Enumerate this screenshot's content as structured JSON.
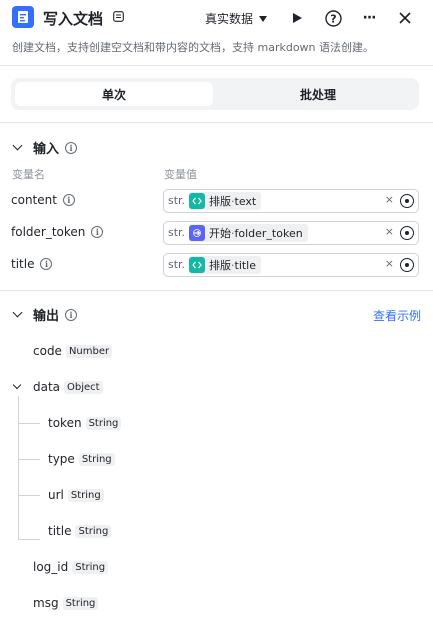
{
  "header": {
    "title": "写入文档",
    "data_mode": "真实数据",
    "description": "创建文档，支持创建空文档和带内容的文档，支持 markdown 语法创建。"
  },
  "tabs": [
    {
      "label": "单次",
      "active": true
    },
    {
      "label": "批处理",
      "active": false
    }
  ],
  "input": {
    "section_title": "输入",
    "col_name": "变量名",
    "col_value": "变量值",
    "params": [
      {
        "name": "content",
        "type": "str.",
        "source": "排版",
        "field": "text",
        "icon": "code-icon"
      },
      {
        "name": "folder_token",
        "type": "str.",
        "source": "开始",
        "field": "folder_token",
        "icon": "start-icon"
      },
      {
        "name": "title",
        "type": "str.",
        "source": "排版",
        "field": "title",
        "icon": "code-icon"
      }
    ]
  },
  "output": {
    "section_title": "输出",
    "example_link": "查看示例",
    "items": [
      {
        "name": "code",
        "type": "Number"
      },
      {
        "name": "data",
        "type": "Object",
        "children": [
          {
            "name": "token",
            "type": "String"
          },
          {
            "name": "type",
            "type": "String"
          },
          {
            "name": "url",
            "type": "String"
          },
          {
            "name": "title",
            "type": "String"
          }
        ]
      },
      {
        "name": "log_id",
        "type": "String"
      },
      {
        "name": "msg",
        "type": "String"
      }
    ]
  },
  "ui": {
    "separator": " · ",
    "clear_glyph": "×",
    "info_glyph": "i",
    "play_glyph": "▶",
    "help_glyph": "?",
    "more_glyph": "···",
    "close_glyph": "✕"
  },
  "colors": {
    "accent": "#3370ff",
    "teal": "#14b8a6",
    "purple": "#5b65f5"
  }
}
